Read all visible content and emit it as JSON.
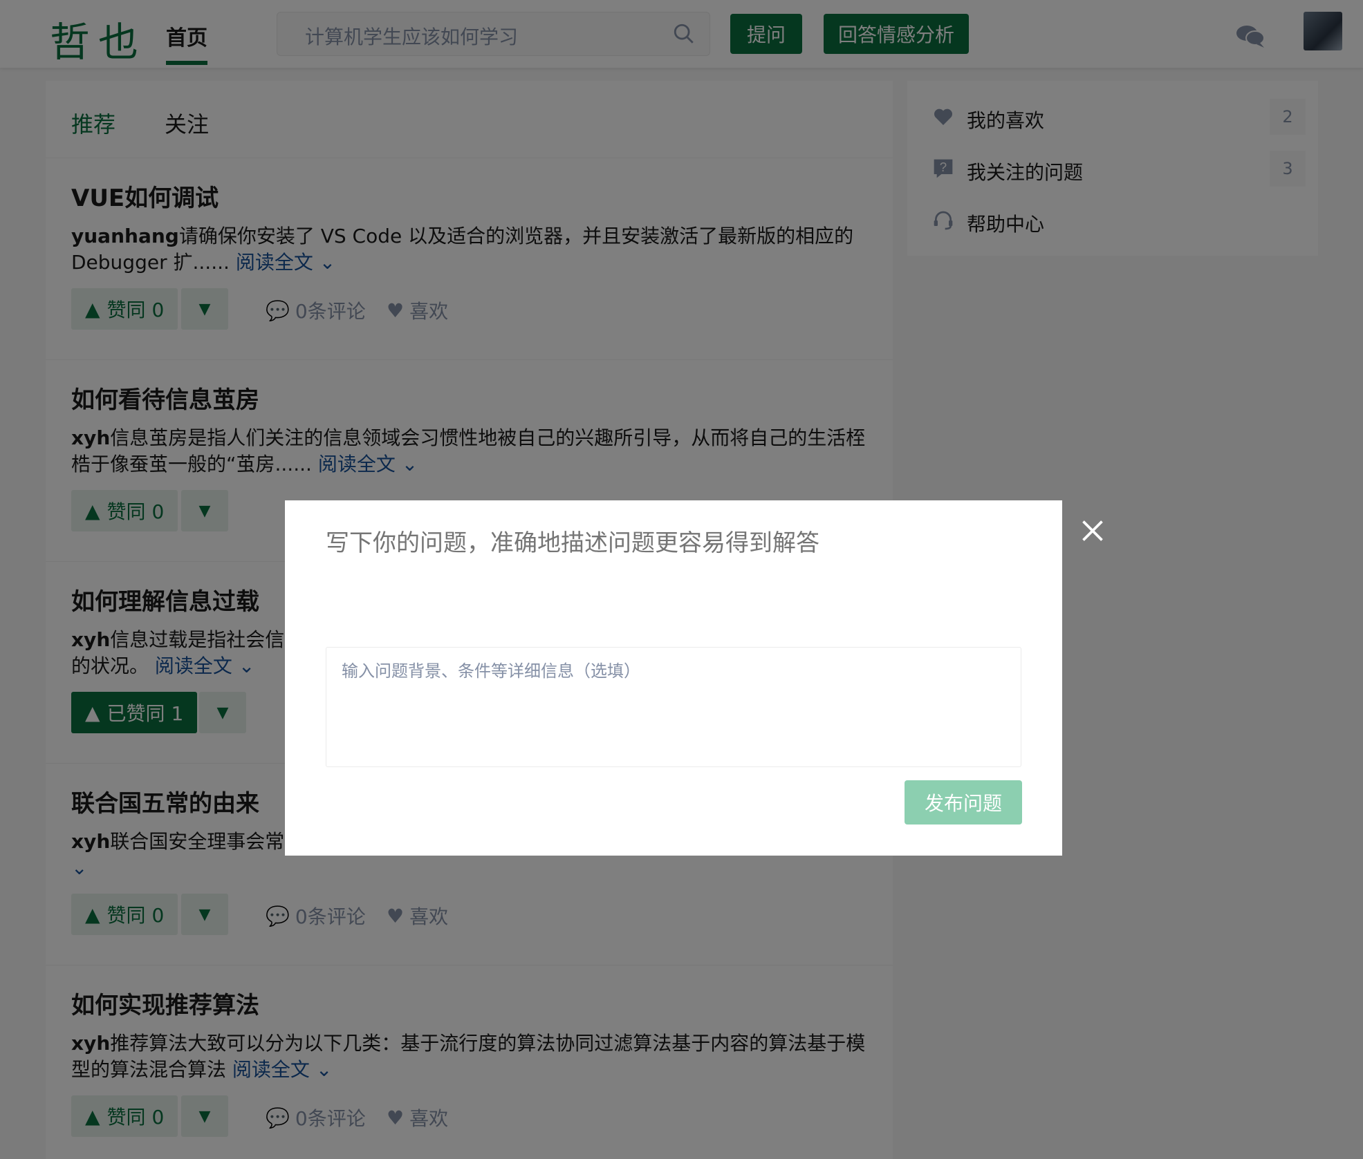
{
  "header": {
    "logo": "哲也",
    "nav_home": "首页",
    "search_placeholder": "计算机学生应该如何学习",
    "ask_button": "提问",
    "analyze_button": "回答情感分析"
  },
  "feed": {
    "tabs": [
      {
        "label": "推荐"
      },
      {
        "label": "关注"
      }
    ],
    "items": [
      {
        "title": "VUE如何调试",
        "author": "yuanhang",
        "excerpt": "请确保你安装了 VS Code 以及适合的浏览器，并且安装激活了最新版的相应的 Debugger 扩......",
        "read_more": "阅读全文",
        "vote_label": "赞同 0",
        "comments": "0条评论",
        "like": "喜欢"
      },
      {
        "title": "如何看待信息茧房",
        "author": "xyh",
        "excerpt": "信息茧房是指人们关注的信息领域会习惯性地被自己的兴趣所引导，从而将自己的生活桎梏于像蚕茧一般的“茧房......",
        "read_more": "阅读全文",
        "vote_label": "赞同 0"
      },
      {
        "title": "如何理解信息过载",
        "author": "xyh",
        "excerpt": "信息过载是指社会信",
        "excerpt_line2": "的状况。",
        "read_more": "阅读全文",
        "vote_label": "已赞同 1"
      },
      {
        "title": "联合国五常的由来",
        "author": "xyh",
        "excerpt": "联合国安全理事会常",
        "vote_label": "赞同 0",
        "comments": "0条评论",
        "like": "喜欢"
      },
      {
        "title": "如何实现推荐算法",
        "author": "xyh",
        "excerpt": "推荐算法大致可以分为以下几类：基于流行度的算法协同过滤算法基于内容的算法基于模型的算法混合算法",
        "read_more": "阅读全文",
        "vote_label": "赞同 0",
        "comments": "0条评论",
        "like": "喜欢"
      }
    ]
  },
  "sidebar": {
    "items": [
      {
        "label": "我的喜欢",
        "count": "2"
      },
      {
        "label": "我关注的问题",
        "count": "3"
      },
      {
        "label": "帮助中心"
      }
    ]
  },
  "modal": {
    "title_placeholder": "写下你的问题，准确地描述问题更容易得到解答",
    "detail_placeholder": "输入问题背景、条件等详细信息（选填）",
    "publish_button": "发布问题"
  },
  "colors": {
    "brand": "#0b6e3f",
    "link": "#175199",
    "publish_disabled": "#8ccfb0"
  }
}
